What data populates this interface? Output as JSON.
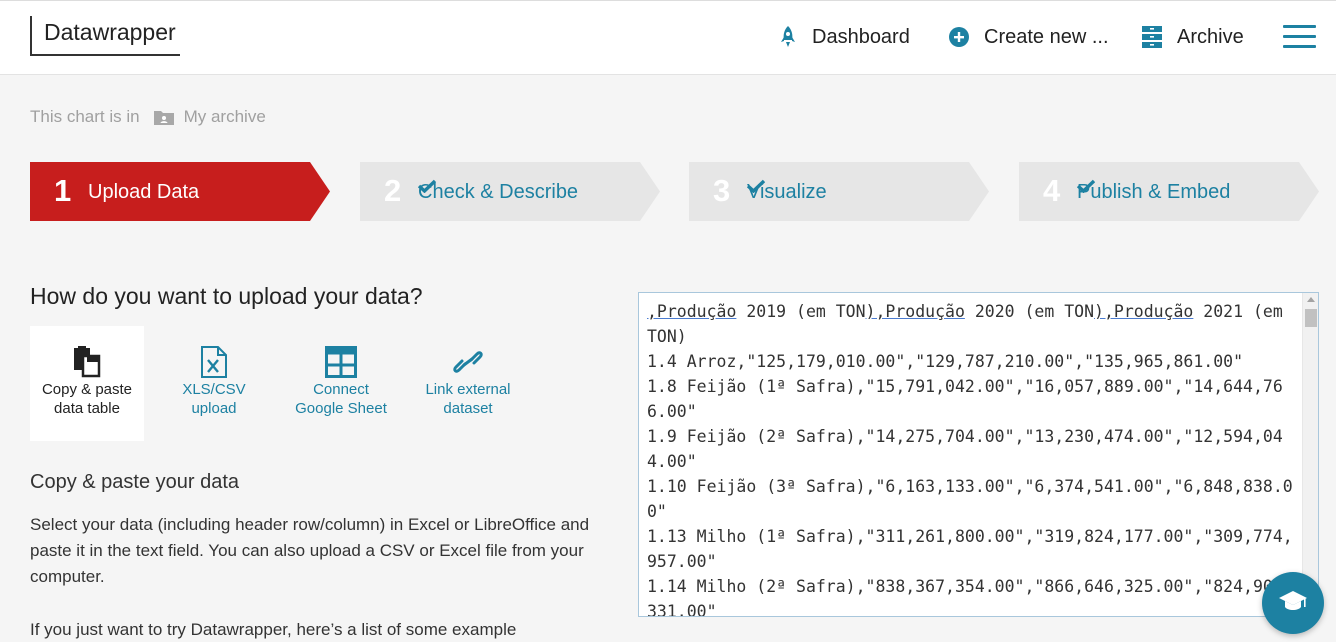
{
  "header": {
    "logo": "Datawrapper",
    "nav": {
      "dashboard": "Dashboard",
      "create_new": "Create new ...",
      "archive": "Archive"
    },
    "icons": {
      "dashboard": "rocket-icon",
      "create_new": "plus-circle-icon",
      "archive": "archive-icon",
      "menu": "hamburger-icon"
    },
    "accent_color": "#1d81a2"
  },
  "breadcrumb": {
    "prefix": "This chart is in",
    "folder_icon": "folder-user-icon",
    "location": "My archive"
  },
  "steps": [
    {
      "number": "1",
      "label": "Upload Data",
      "active": true,
      "checked": false,
      "color": "#c71e1d"
    },
    {
      "number": "2",
      "label": "Check & Describe",
      "active": false,
      "checked": true
    },
    {
      "number": "3",
      "label": "Visualize",
      "active": false,
      "checked": true
    },
    {
      "number": "4",
      "label": "Publish & Embed",
      "active": false,
      "checked": true
    }
  ],
  "upload": {
    "question": "How do you want to upload your data?",
    "options": [
      {
        "label_line1": "Copy & paste",
        "label_line2": "data table",
        "icon": "paste-icon",
        "selected": true
      },
      {
        "label_line1": "XLS/CSV",
        "label_line2": "upload",
        "icon": "excel-file-icon",
        "selected": false
      },
      {
        "label_line1": "Connect",
        "label_line2": "Google Sheet",
        "icon": "table-grid-icon",
        "selected": false
      },
      {
        "label_line1": "Link external",
        "label_line2": "dataset",
        "icon": "link-icon",
        "selected": false
      }
    ],
    "section_title": "Copy & paste your data",
    "description": "Select your data (including header row/column) in Excel or LibreOffice and paste it in the text field. You can also upload a CSV or Excel file from your computer.",
    "try_text": "If you just want to try Datawrapper, here’s a list of some example"
  },
  "textarea": {
    "header_parts": [
      ",Produção",
      " 2019 (em TON",
      "),Produção",
      " 2020 (em TON",
      "),Produção",
      " 2021 (em TON)"
    ],
    "rows": [
      "1.4 Arroz,\"125,179,010.00\",\"129,787,210.00\",\"135,965,861.00\"",
      "1.8 Feijão (1ª Safra),\"15,791,042.00\",\"16,057,889.00\",\"14,644,766.00\"",
      "1.9 Feijão (2ª Safra),\"14,275,704.00\",\"13,230,474.00\",\"12,594,044.00\"",
      "1.10 Feijão (3ª Safra),\"6,163,133.00\",\"6,374,541.00\",\"6,848,838.00\"",
      "1.13 Milho (1ª Safra),\"311,261,800.00\",\"319,824,177.00\",\"309,774,957.00\"",
      "1.14 Milho (2ª Safra),\"838,367,354.00\",\"866,646,325.00\",\"824,903,331.00\""
    ]
  },
  "help": {
    "icon": "graduation-cap-icon"
  }
}
